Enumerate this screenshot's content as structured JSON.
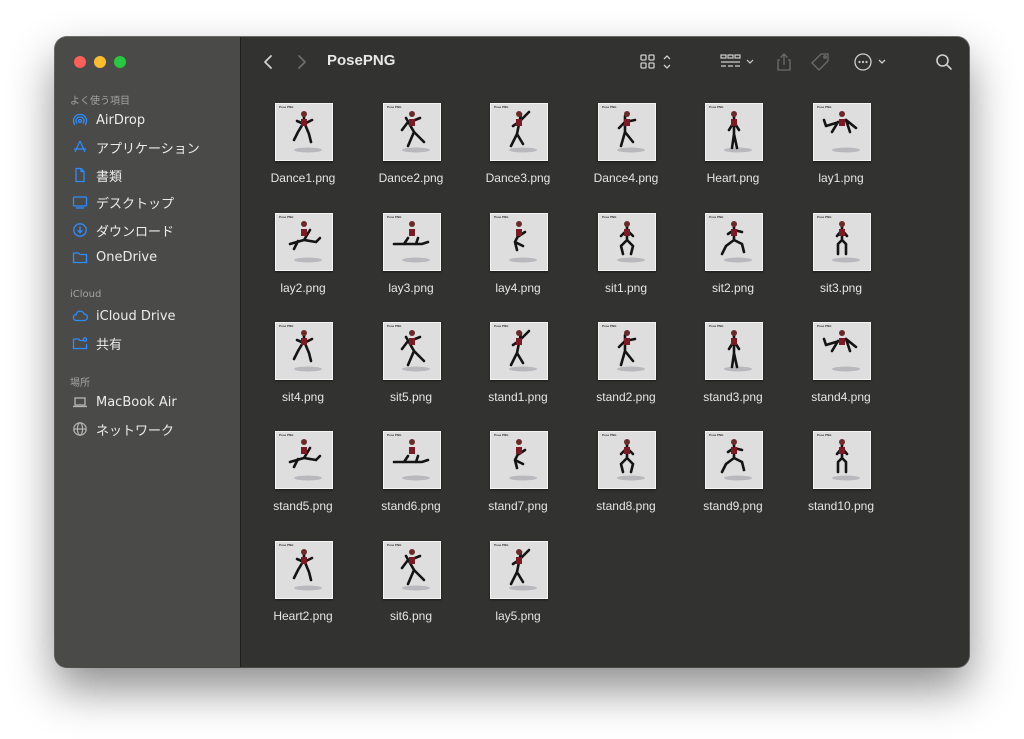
{
  "window": {
    "title": "PosePNG"
  },
  "sidebar": {
    "favorites_title": "よく使う項目",
    "favorites": [
      {
        "label": "AirDrop",
        "icon": "airdrop-icon"
      },
      {
        "label": "アプリケーション",
        "icon": "applications-icon"
      },
      {
        "label": "書類",
        "icon": "documents-icon"
      },
      {
        "label": "デスクトップ",
        "icon": "desktop-icon"
      },
      {
        "label": "ダウンロード",
        "icon": "downloads-icon"
      },
      {
        "label": "OneDrive",
        "icon": "folder-icon"
      }
    ],
    "icloud_title": "iCloud",
    "icloud": [
      {
        "label": "iCloud Drive",
        "icon": "cloud-icon"
      },
      {
        "label": "共有",
        "icon": "shared-folder-icon"
      }
    ],
    "locations_title": "場所",
    "locations": [
      {
        "label": "MacBook Air",
        "icon": "laptop-icon"
      },
      {
        "label": "ネットワーク",
        "icon": "network-icon"
      }
    ]
  },
  "files": [
    {
      "name": "Dance1.png",
      "thumb_label": "Pose PNG"
    },
    {
      "name": "Dance2.png",
      "thumb_label": "Pose PNG"
    },
    {
      "name": "Dance3.png",
      "thumb_label": "Pose PNG"
    },
    {
      "name": "Dance4.png",
      "thumb_label": "Pose PNG"
    },
    {
      "name": "Heart.png",
      "thumb_label": "Pose PNG"
    },
    {
      "name": "lay1.png",
      "thumb_label": "Pose PNG"
    },
    {
      "name": "lay2.png",
      "thumb_label": "Pose PNG"
    },
    {
      "name": "lay3.png",
      "thumb_label": "Pose PNG"
    },
    {
      "name": "lay4.png",
      "thumb_label": "Pose PNG"
    },
    {
      "name": "sit1.png",
      "thumb_label": "Pose PNG"
    },
    {
      "name": "sit2.png",
      "thumb_label": "Pose PNG"
    },
    {
      "name": "sit3.png",
      "thumb_label": "Pose PNG"
    },
    {
      "name": "sit4.png",
      "thumb_label": "Pose PNG"
    },
    {
      "name": "sit5.png",
      "thumb_label": "Pose PNG"
    },
    {
      "name": "stand1.png",
      "thumb_label": "Pose PNG"
    },
    {
      "name": "stand2.png",
      "thumb_label": "Pose PNG"
    },
    {
      "name": "stand3.png",
      "thumb_label": "Pose PNG"
    },
    {
      "name": "stand4.png",
      "thumb_label": "Pose PNG"
    },
    {
      "name": "stand5.png",
      "thumb_label": "Pose PNG"
    },
    {
      "name": "stand6.png",
      "thumb_label": "Pose PNG"
    },
    {
      "name": "stand7.png",
      "thumb_label": "Pose PNG"
    },
    {
      "name": "stand8.png",
      "thumb_label": "Pose PNG"
    },
    {
      "name": "stand9.png",
      "thumb_label": "Pose PNG"
    },
    {
      "name": "stand10.png",
      "thumb_label": "Pose PNG"
    },
    {
      "name": "Heart2.png",
      "thumb_label": "Pose PNG"
    },
    {
      "name": "sit6.png",
      "thumb_label": "Pose PNG"
    },
    {
      "name": "lay5.png",
      "thumb_label": "Pose PNG"
    }
  ],
  "colors": {
    "sidebar_bg": "#4a4a48",
    "content_bg": "#323230",
    "accent_blue": "#2e8cff",
    "close": "#fe5f57",
    "minimize": "#febc2e",
    "maximize": "#28c840"
  }
}
